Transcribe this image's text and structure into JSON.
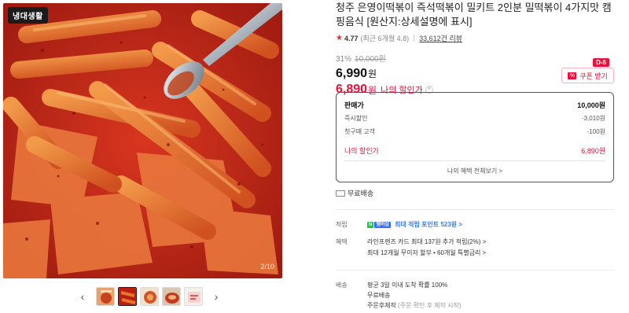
{
  "hero": {
    "badge": "냉대생활",
    "counter": "2/10"
  },
  "title": "청주 은영이떡볶이 즉석떡볶이 밀키트 2인분 밀떡볶이 4가지맛 캠핑음식 [원산지:상세설명에 표시]",
  "rating": {
    "value": "4.77",
    "sub": "(최근 6개월 4.8)",
    "reviews": "33,612건 리뷰"
  },
  "pricing": {
    "discount_rate": "31%",
    "original_price": "10,000원",
    "sale_price": "6,990",
    "won": "원",
    "my_price": "6,890",
    "my_won": "원",
    "my_label": "나의 할인가",
    "chevron": "^"
  },
  "coupon": {
    "dday": "D-6",
    "icon_text": "%",
    "label": "쿠폰 받기"
  },
  "price_box": {
    "header_label": "판매가",
    "header_value": "10,000원",
    "rows": [
      {
        "label": "즉시할인",
        "value": "-3,010원"
      },
      {
        "label": "첫구매 고객",
        "value": "-100원"
      }
    ],
    "my_label": "나의 할인가",
    "my_value": "6,890원",
    "benefit_link": "나의 혜택 전체보기 >"
  },
  "shipping": {
    "text": "무료배송"
  },
  "points": {
    "label": "적립",
    "chip1": "N",
    "chip2": "멤버십",
    "link": "최대 적립 포인트 523원 >"
  },
  "benefits": {
    "label": "혜택",
    "line1": "라인프렌즈 카드 최대 137원 추가 적립(2%) >",
    "line2": "최대 12개월 무이자 할부 • 60개월 특별금리 >"
  },
  "delivery": {
    "label": "배송",
    "line1": "평균 3일 이내 도착 확률 100%",
    "line2": "무료배송",
    "line3_main": "주문후제작",
    "line3_muted": "(주문 확인 후 제작 시작)"
  },
  "thumbs": {
    "prev": "‹",
    "next": "›"
  },
  "colors": {
    "accent": "#e8123c",
    "sauce": "#c8241a",
    "rice_cake": "#e36a2a",
    "point_green": "#1fc84a",
    "point_link": "#3b7bf0"
  }
}
